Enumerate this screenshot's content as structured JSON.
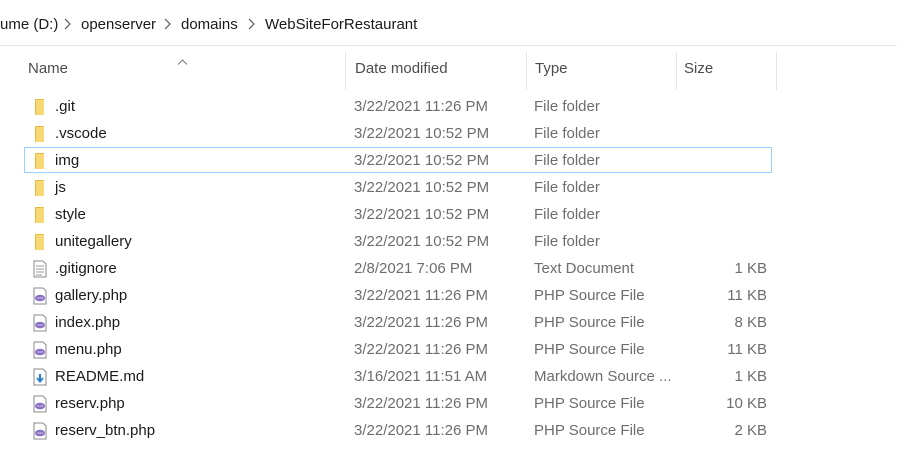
{
  "breadcrumb": [
    "ume (D:)",
    "openserver",
    "domains",
    "WebSiteForRestaurant"
  ],
  "columns": {
    "name": "Name",
    "date": "Date modified",
    "type": "Type",
    "size": "Size"
  },
  "files": [
    {
      "name": ".git",
      "date": "3/22/2021 11:26 PM",
      "type": "File folder",
      "size": "",
      "icon": "folder-icon"
    },
    {
      "name": ".vscode",
      "date": "3/22/2021 10:52 PM",
      "type": "File folder",
      "size": "",
      "icon": "folder-icon"
    },
    {
      "name": "img",
      "date": "3/22/2021 10:52 PM",
      "type": "File folder",
      "size": "",
      "icon": "folder-icon",
      "selected": true
    },
    {
      "name": "js",
      "date": "3/22/2021 10:52 PM",
      "type": "File folder",
      "size": "",
      "icon": "folder-icon"
    },
    {
      "name": "style",
      "date": "3/22/2021 10:52 PM",
      "type": "File folder",
      "size": "",
      "icon": "folder-icon"
    },
    {
      "name": "unitegallery",
      "date": "3/22/2021 10:52 PM",
      "type": "File folder",
      "size": "",
      "icon": "folder-icon"
    },
    {
      "name": ".gitignore",
      "date": "2/8/2021 7:06 PM",
      "type": "Text Document",
      "size": "1 KB",
      "icon": "text-document-icon"
    },
    {
      "name": "gallery.php",
      "date": "3/22/2021 11:26 PM",
      "type": "PHP Source File",
      "size": "11 KB",
      "icon": "php-file-icon"
    },
    {
      "name": "index.php",
      "date": "3/22/2021 11:26 PM",
      "type": "PHP Source File",
      "size": "8 KB",
      "icon": "php-file-icon"
    },
    {
      "name": "menu.php",
      "date": "3/22/2021 11:26 PM",
      "type": "PHP Source File",
      "size": "11 KB",
      "icon": "php-file-icon"
    },
    {
      "name": "README.md",
      "date": "3/16/2021 11:51 AM",
      "type": "Markdown Source ...",
      "size": "1 KB",
      "icon": "markdown-file-icon"
    },
    {
      "name": "reserv.php",
      "date": "3/22/2021 11:26 PM",
      "type": "PHP Source File",
      "size": "10 KB",
      "icon": "php-file-icon"
    },
    {
      "name": "reserv_btn.php",
      "date": "3/22/2021 11:26 PM",
      "type": "PHP Source File",
      "size": "2 KB",
      "icon": "php-file-icon"
    }
  ],
  "colors": {
    "selection_border": "#99d1ff",
    "folder": "#f8d775",
    "php": "#8a6fc7",
    "markdown": "#2b7fd0"
  }
}
